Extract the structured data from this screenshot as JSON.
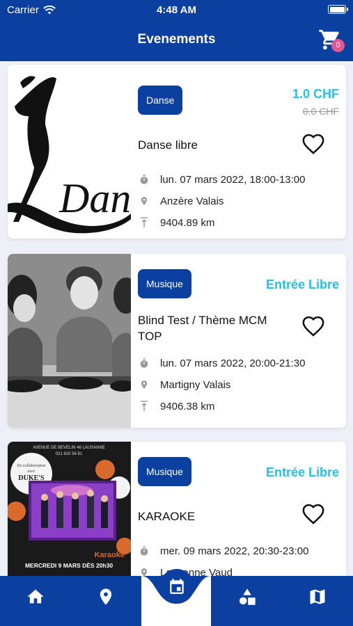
{
  "status_bar": {
    "carrier": "Carrier",
    "time": "4:48 AM"
  },
  "header": {
    "title": "Evenements",
    "cart_count": "0",
    "cart_icon": "cart-icon"
  },
  "events": [
    {
      "category": "Danse",
      "price": "1.0 CHF",
      "old_price": "0.0 CHF",
      "free_label": "",
      "title": "Danse libre",
      "date": "lun. 07 mars 2022, 18:00-13:00",
      "location": "Anzère Valais",
      "distance": "9404.89 km",
      "image_text": "Dan"
    },
    {
      "category": "Musique",
      "price": "",
      "old_price": "",
      "free_label": "Entrée Libre",
      "title": "Blind Test / Thème MCM TOP",
      "date": "lun. 07 mars 2022, 20:00-21:30",
      "location": "Martigny Valais",
      "distance": "9406.38 km"
    },
    {
      "category": "Musique",
      "price": "",
      "old_price": "",
      "free_label": "Entrée Libre",
      "title": "KARAOKE",
      "date": "mer. 09 mars 2022, 20:30-23:00",
      "location": "Lausanne Vaud",
      "distance": "",
      "poster": {
        "address": "AVENUE DE BEVELIN 46 LAUSANNE",
        "phone": "021 625 56 81",
        "badge_line1": "En collaboration",
        "badge_line2": "avec",
        "badge_brand": "DUKE'S",
        "headline": "Karaoke",
        "date_line": "MERCREDI 9 MARS DÈS 20h30"
      }
    }
  ],
  "tabbar": {
    "items": [
      "home-icon",
      "location-pin-icon",
      "calendar-icon",
      "shapes-icon",
      "map-icon"
    ]
  },
  "colors": {
    "primary": "#0b3fa0",
    "accent": "#22c3e6",
    "badge": "#e05a8f"
  }
}
